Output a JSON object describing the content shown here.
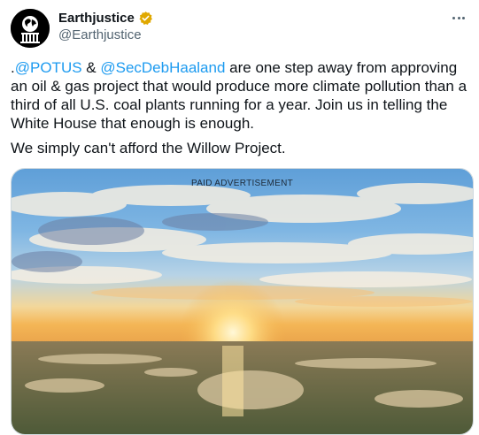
{
  "account": {
    "display_name": "Earthjustice",
    "handle": "@Earthjustice",
    "verified_badge_color": "#e0a800"
  },
  "tweet": {
    "lead": ".",
    "mention_1": "@POTUS",
    "amp": " & ",
    "mention_2": "@SecDebHaaland",
    "body": " are one step away from approving an oil & gas project that would produce more climate pollution than a third of all U.S. coal plants running for a year. Join us in telling the White House that enough is enough.",
    "line_2": "We simply can't afford the Willow Project."
  },
  "media": {
    "overlay_label": "PAID ADVERTISEMENT"
  },
  "icons": {
    "avatar": "earthjustice-logo-icon",
    "verified": "verified-badge-icon",
    "more": "more-options-icon"
  },
  "colors": {
    "link": "#1d9bf0",
    "text": "#0f1419",
    "secondary": "#536471"
  }
}
